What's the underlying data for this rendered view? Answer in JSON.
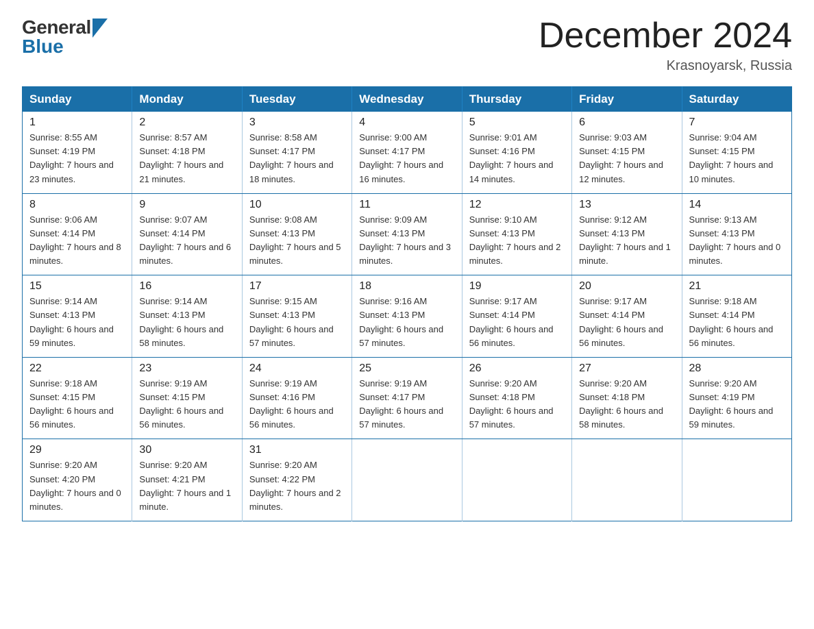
{
  "header": {
    "logo_general": "General",
    "logo_blue": "Blue",
    "month_title": "December 2024",
    "location": "Krasnoyarsk, Russia"
  },
  "days_of_week": [
    "Sunday",
    "Monday",
    "Tuesday",
    "Wednesday",
    "Thursday",
    "Friday",
    "Saturday"
  ],
  "weeks": [
    [
      {
        "num": "1",
        "sunrise": "Sunrise: 8:55 AM",
        "sunset": "Sunset: 4:19 PM",
        "daylight": "Daylight: 7 hours and 23 minutes."
      },
      {
        "num": "2",
        "sunrise": "Sunrise: 8:57 AM",
        "sunset": "Sunset: 4:18 PM",
        "daylight": "Daylight: 7 hours and 21 minutes."
      },
      {
        "num": "3",
        "sunrise": "Sunrise: 8:58 AM",
        "sunset": "Sunset: 4:17 PM",
        "daylight": "Daylight: 7 hours and 18 minutes."
      },
      {
        "num": "4",
        "sunrise": "Sunrise: 9:00 AM",
        "sunset": "Sunset: 4:17 PM",
        "daylight": "Daylight: 7 hours and 16 minutes."
      },
      {
        "num": "5",
        "sunrise": "Sunrise: 9:01 AM",
        "sunset": "Sunset: 4:16 PM",
        "daylight": "Daylight: 7 hours and 14 minutes."
      },
      {
        "num": "6",
        "sunrise": "Sunrise: 9:03 AM",
        "sunset": "Sunset: 4:15 PM",
        "daylight": "Daylight: 7 hours and 12 minutes."
      },
      {
        "num": "7",
        "sunrise": "Sunrise: 9:04 AM",
        "sunset": "Sunset: 4:15 PM",
        "daylight": "Daylight: 7 hours and 10 minutes."
      }
    ],
    [
      {
        "num": "8",
        "sunrise": "Sunrise: 9:06 AM",
        "sunset": "Sunset: 4:14 PM",
        "daylight": "Daylight: 7 hours and 8 minutes."
      },
      {
        "num": "9",
        "sunrise": "Sunrise: 9:07 AM",
        "sunset": "Sunset: 4:14 PM",
        "daylight": "Daylight: 7 hours and 6 minutes."
      },
      {
        "num": "10",
        "sunrise": "Sunrise: 9:08 AM",
        "sunset": "Sunset: 4:13 PM",
        "daylight": "Daylight: 7 hours and 5 minutes."
      },
      {
        "num": "11",
        "sunrise": "Sunrise: 9:09 AM",
        "sunset": "Sunset: 4:13 PM",
        "daylight": "Daylight: 7 hours and 3 minutes."
      },
      {
        "num": "12",
        "sunrise": "Sunrise: 9:10 AM",
        "sunset": "Sunset: 4:13 PM",
        "daylight": "Daylight: 7 hours and 2 minutes."
      },
      {
        "num": "13",
        "sunrise": "Sunrise: 9:12 AM",
        "sunset": "Sunset: 4:13 PM",
        "daylight": "Daylight: 7 hours and 1 minute."
      },
      {
        "num": "14",
        "sunrise": "Sunrise: 9:13 AM",
        "sunset": "Sunset: 4:13 PM",
        "daylight": "Daylight: 7 hours and 0 minutes."
      }
    ],
    [
      {
        "num": "15",
        "sunrise": "Sunrise: 9:14 AM",
        "sunset": "Sunset: 4:13 PM",
        "daylight": "Daylight: 6 hours and 59 minutes."
      },
      {
        "num": "16",
        "sunrise": "Sunrise: 9:14 AM",
        "sunset": "Sunset: 4:13 PM",
        "daylight": "Daylight: 6 hours and 58 minutes."
      },
      {
        "num": "17",
        "sunrise": "Sunrise: 9:15 AM",
        "sunset": "Sunset: 4:13 PM",
        "daylight": "Daylight: 6 hours and 57 minutes."
      },
      {
        "num": "18",
        "sunrise": "Sunrise: 9:16 AM",
        "sunset": "Sunset: 4:13 PM",
        "daylight": "Daylight: 6 hours and 57 minutes."
      },
      {
        "num": "19",
        "sunrise": "Sunrise: 9:17 AM",
        "sunset": "Sunset: 4:14 PM",
        "daylight": "Daylight: 6 hours and 56 minutes."
      },
      {
        "num": "20",
        "sunrise": "Sunrise: 9:17 AM",
        "sunset": "Sunset: 4:14 PM",
        "daylight": "Daylight: 6 hours and 56 minutes."
      },
      {
        "num": "21",
        "sunrise": "Sunrise: 9:18 AM",
        "sunset": "Sunset: 4:14 PM",
        "daylight": "Daylight: 6 hours and 56 minutes."
      }
    ],
    [
      {
        "num": "22",
        "sunrise": "Sunrise: 9:18 AM",
        "sunset": "Sunset: 4:15 PM",
        "daylight": "Daylight: 6 hours and 56 minutes."
      },
      {
        "num": "23",
        "sunrise": "Sunrise: 9:19 AM",
        "sunset": "Sunset: 4:15 PM",
        "daylight": "Daylight: 6 hours and 56 minutes."
      },
      {
        "num": "24",
        "sunrise": "Sunrise: 9:19 AM",
        "sunset": "Sunset: 4:16 PM",
        "daylight": "Daylight: 6 hours and 56 minutes."
      },
      {
        "num": "25",
        "sunrise": "Sunrise: 9:19 AM",
        "sunset": "Sunset: 4:17 PM",
        "daylight": "Daylight: 6 hours and 57 minutes."
      },
      {
        "num": "26",
        "sunrise": "Sunrise: 9:20 AM",
        "sunset": "Sunset: 4:18 PM",
        "daylight": "Daylight: 6 hours and 57 minutes."
      },
      {
        "num": "27",
        "sunrise": "Sunrise: 9:20 AM",
        "sunset": "Sunset: 4:18 PM",
        "daylight": "Daylight: 6 hours and 58 minutes."
      },
      {
        "num": "28",
        "sunrise": "Sunrise: 9:20 AM",
        "sunset": "Sunset: 4:19 PM",
        "daylight": "Daylight: 6 hours and 59 minutes."
      }
    ],
    [
      {
        "num": "29",
        "sunrise": "Sunrise: 9:20 AM",
        "sunset": "Sunset: 4:20 PM",
        "daylight": "Daylight: 7 hours and 0 minutes."
      },
      {
        "num": "30",
        "sunrise": "Sunrise: 9:20 AM",
        "sunset": "Sunset: 4:21 PM",
        "daylight": "Daylight: 7 hours and 1 minute."
      },
      {
        "num": "31",
        "sunrise": "Sunrise: 9:20 AM",
        "sunset": "Sunset: 4:22 PM",
        "daylight": "Daylight: 7 hours and 2 minutes."
      },
      null,
      null,
      null,
      null
    ]
  ]
}
